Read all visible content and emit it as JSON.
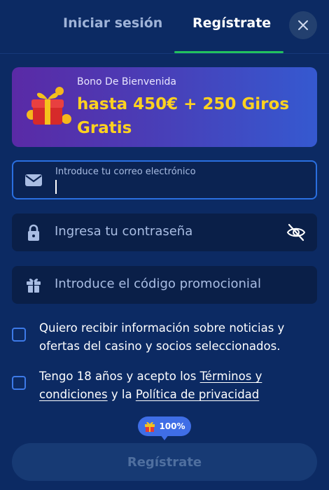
{
  "tabs": {
    "login": "Iniciar sesión",
    "register": "Regístrate"
  },
  "bonus": {
    "label": "Bono De Bienvenida",
    "amount": "hasta 450€ + 250 Giros Gratis"
  },
  "form": {
    "email_label": "Introduce tu correo electrónico",
    "email_value": "",
    "password_placeholder": "Ingresa tu contraseña",
    "promo_placeholder": "Introduce el código promocionial"
  },
  "consents": {
    "marketing": "Quiero recibir información sobre noticias y ofertas del casino y socios seleccionados.",
    "age_prefix": "Tengo 18 años y acepto los ",
    "terms_link": "Términos y condiciones",
    "age_middle": " y la ",
    "privacy_link": "Política de privacidad"
  },
  "badge": {
    "percent": "100%"
  },
  "submit": {
    "label": "Regístrate"
  },
  "icons": {
    "close": "close-icon",
    "gift": "gift-icon",
    "email": "envelope-icon",
    "password": "lock-icon",
    "eye": "eye-slash-icon",
    "promo": "gift-icon"
  },
  "colors": {
    "accent": "#22c15e",
    "bonus_amount": "#ffd21f",
    "primary": "#3f6ee6",
    "background": "#0c2a63"
  }
}
